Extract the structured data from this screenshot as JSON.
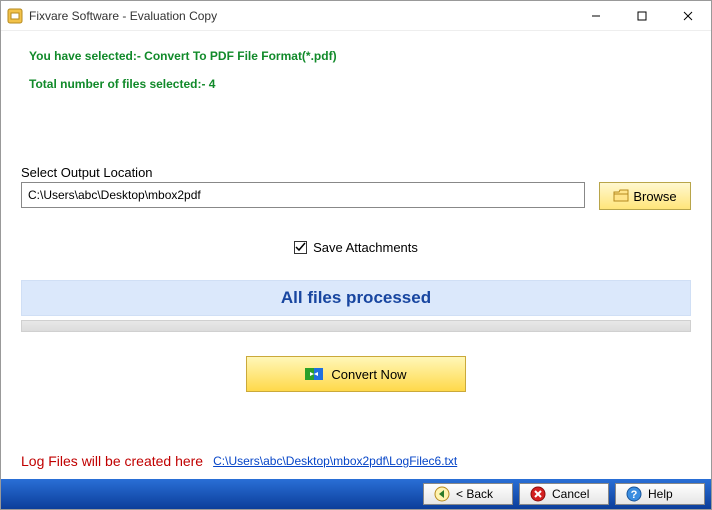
{
  "titlebar": {
    "title": "Fixvare Software - Evaluation Copy"
  },
  "summary": {
    "line1": "You have selected:- Convert To PDF File Format(*.pdf)",
    "line2": "Total number of files selected:- 4"
  },
  "output": {
    "label": "Select Output Location",
    "path": "C:\\Users\\abc\\Desktop\\mbox2pdf",
    "browse": "Browse"
  },
  "options": {
    "save_attachments_label": "Save Attachments",
    "save_attachments_checked": "☑"
  },
  "status": {
    "text": "All files processed"
  },
  "actions": {
    "convert": "Convert Now"
  },
  "log": {
    "label": "Log Files will be created here",
    "path": "C:\\Users\\abc\\Desktop\\mbox2pdf\\LogFilec6.txt"
  },
  "footer": {
    "back": "< Back",
    "cancel": "Cancel",
    "help": "Help"
  }
}
